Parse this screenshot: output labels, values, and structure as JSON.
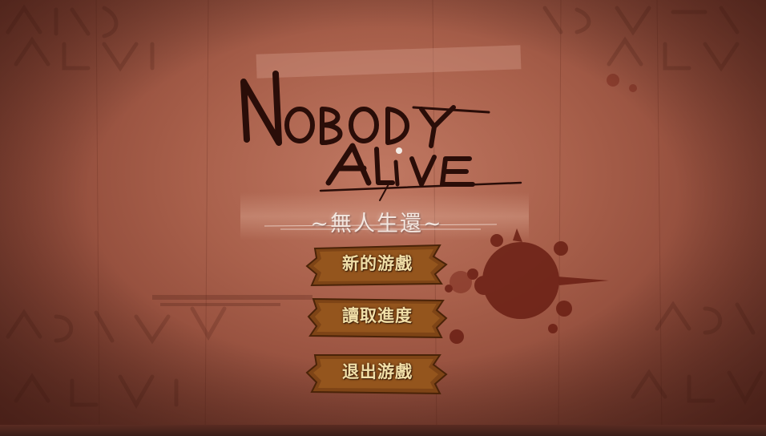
{
  "game": {
    "title_line1": "NOBODY",
    "title_line2": "ALIVE",
    "subtitle": "~無人生還~"
  },
  "menu": {
    "new_game": "新的游戲",
    "load_game": "讀取進度",
    "exit_game": "退出游戲"
  },
  "colors": {
    "background": "#a9604b",
    "button_wood": "#8a4a17",
    "button_text": "#f1dfa8",
    "title_ink": "#2a0d08"
  }
}
